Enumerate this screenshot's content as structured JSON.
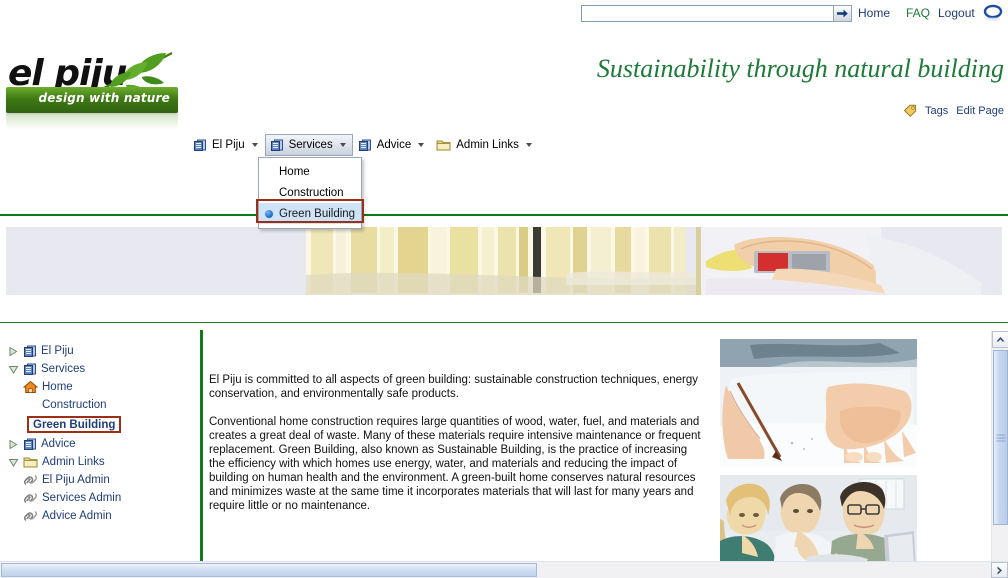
{
  "topbar": {
    "search_value": "",
    "search_placeholder": "",
    "go_label": "Go",
    "links": [
      {
        "label": "Home"
      },
      {
        "label": "FAQ"
      },
      {
        "label": "Logout"
      }
    ],
    "avatar_label": "Account"
  },
  "brand": {
    "name": "el piju",
    "band_text": "design with nature",
    "tagline": "Sustainability through natural building"
  },
  "pagetools": {
    "tags_label": "Tags",
    "edit_label": "Edit Page"
  },
  "menubar": {
    "items": [
      {
        "label": "El Piju",
        "icon": "page-stack-icon",
        "active": false
      },
      {
        "label": "Services",
        "icon": "page-stack-icon",
        "active": true
      },
      {
        "label": "Advice",
        "icon": "page-stack-icon",
        "active": false
      },
      {
        "label": "Admin Links",
        "icon": "folder-icon",
        "active": false
      }
    ]
  },
  "dropdown": {
    "open_for": "Services",
    "items": [
      {
        "label": "Home",
        "selected": false
      },
      {
        "label": "Construction",
        "selected": false
      },
      {
        "label": "Green Building",
        "selected": true
      }
    ]
  },
  "sidebar": {
    "nodes": [
      {
        "label": "El Piju",
        "icon": "page-stack-icon",
        "state": "collapsed",
        "level": 0
      },
      {
        "label": "Services",
        "icon": "page-stack-icon",
        "state": "expanded",
        "level": 0
      },
      {
        "label": "Home",
        "icon": "home-icon",
        "state": "leaf",
        "level": 1
      },
      {
        "label": "Construction",
        "icon": "none",
        "state": "leaf",
        "level": 1
      },
      {
        "label": "Green Building",
        "icon": "none",
        "state": "current",
        "level": 1
      },
      {
        "label": "Advice",
        "icon": "page-stack-icon",
        "state": "collapsed",
        "level": 0
      },
      {
        "label": "Admin Links",
        "icon": "folder-icon",
        "state": "expanded",
        "level": 0
      },
      {
        "label": "El Piju Admin",
        "icon": "link-icon",
        "state": "leaf",
        "level": 1
      },
      {
        "label": "Services Admin",
        "icon": "link-icon",
        "state": "leaf",
        "level": 1
      },
      {
        "label": "Advice Admin",
        "icon": "link-icon",
        "state": "leaf",
        "level": 1
      }
    ]
  },
  "content": {
    "paragraph1": "El Piju is committed to all aspects of green building: sustainable construction techniques, energy conservation, and environmentally safe products.",
    "paragraph2": "Conventional home construction requires large quantities of wood, water, fuel, and materials and creates a great deal of waste. Many of these materials require intensive maintenance or frequent replacement. Green Building, also known as Sustainable Building, is the practice of increasing the efficiency with which homes use energy, water, and materials and reducing the impact of building on human health and the environment. A green-built home conserves natural resources and minimizes waste at the same time it incorporates materials that will last for many years and require little or no maintenance.",
    "image1_alt": "Hands drawing plans on paper with a pencil",
    "image2_alt": "Three colleagues reviewing building plans at a table",
    "banner_alt": "Hand with a tape measure against wooden planks"
  },
  "colors": {
    "brand_green": "#1d7a38",
    "rule_green": "#0d7a14",
    "link_blue": "#1f3d7a",
    "highlight_red": "#9c2f14",
    "selection_blue": "#cfe3f7"
  }
}
